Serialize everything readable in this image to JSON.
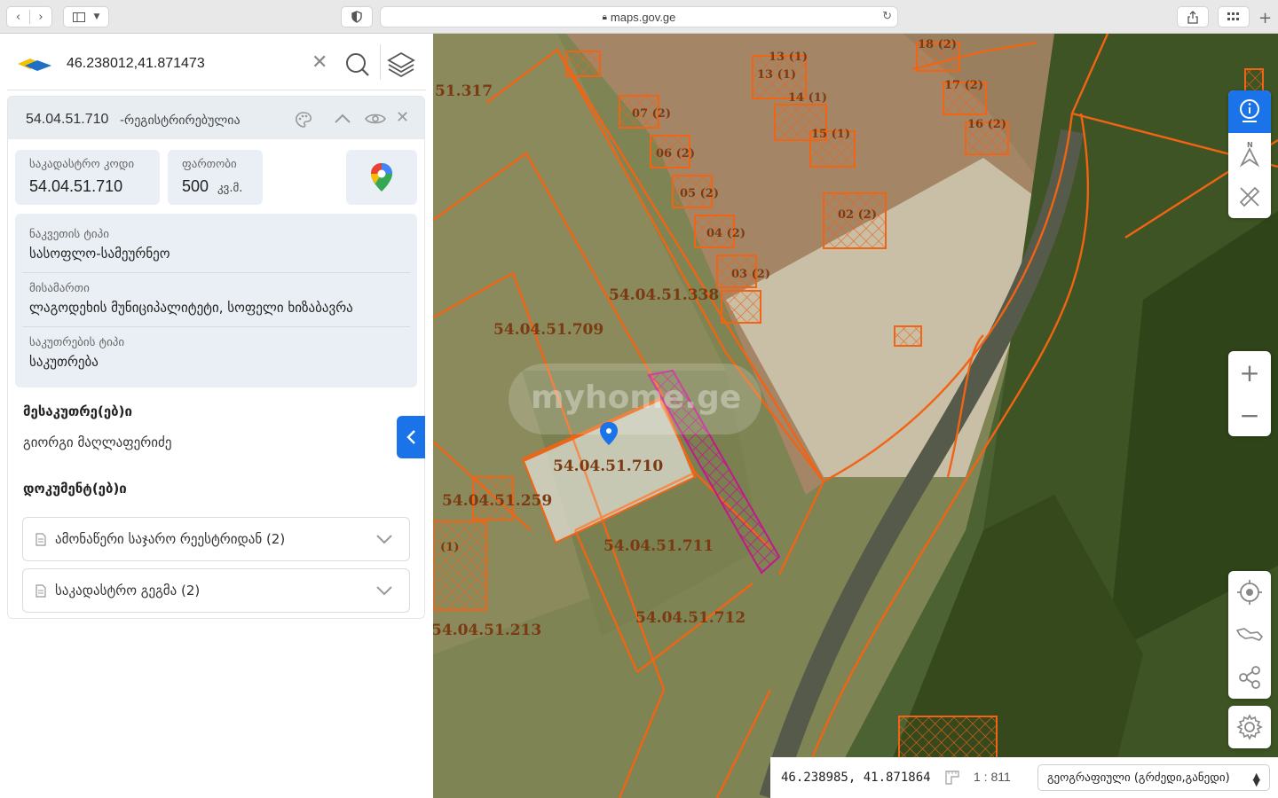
{
  "browser": {
    "url": "maps.gov.ge"
  },
  "search": {
    "value": "46.238012,41.871473"
  },
  "parcel": {
    "id": "54.04.51.710",
    "status": "-რეგისტრირებულია",
    "code_label": "საკადასტრო კოდი",
    "code_value": "54.04.51.710",
    "area_label": "ფართობი",
    "area_value": "500",
    "area_unit": "კვ.მ.",
    "land_type_label": "ნაკვეთის ტიპი",
    "land_type_value": "სასოფლო-სამეურნეო",
    "address_label": "მისამართი",
    "address_value": "ლაგოდეხის მუნიციპალიტეტი, სოფელი ხიზაბავრა",
    "ownership_label": "საკუთრების ტიპი",
    "ownership_value": "საკუთრება"
  },
  "owners": {
    "title": "მესაკუთრე(ებ)ი",
    "items": [
      "გიორგი მაღლაფერიძე"
    ]
  },
  "documents": {
    "title": "დოკუმენტ(ებ)ი",
    "items": [
      {
        "label": "ამონაწერი საჯარო რეესტრიდან (2)"
      },
      {
        "label": "საკადასტრო გეგმა (2)"
      }
    ]
  },
  "map": {
    "parcel_labels": [
      "51.317",
      "54.04.51.338",
      "54.04.51.709",
      "54.04.51.710",
      "54.04.51.711",
      "54.04.51.712",
      "54.04.51.213",
      "54.04.51.259",
      "(1)"
    ],
    "building_labels": [
      "18 (2)",
      "13 (1)",
      "13 (1)",
      "17 (2)",
      "07 (2)",
      "14 (1)",
      "16 (2)",
      "06 (2)",
      "15 (1)",
      "05 (2)",
      "02 (2)",
      "04 (2)",
      "03 (2)"
    ],
    "watermark": "myhome.ge"
  },
  "status_bar": {
    "coordinates": "46.238985, 41.871864",
    "scale": "1 : 811",
    "projection": "გეოგრაფიული (გრძედი,განედი)"
  },
  "colors": {
    "accent": "#1a73e8",
    "parcel_border": "#f06414",
    "selected_hatch": "#c2188c"
  }
}
